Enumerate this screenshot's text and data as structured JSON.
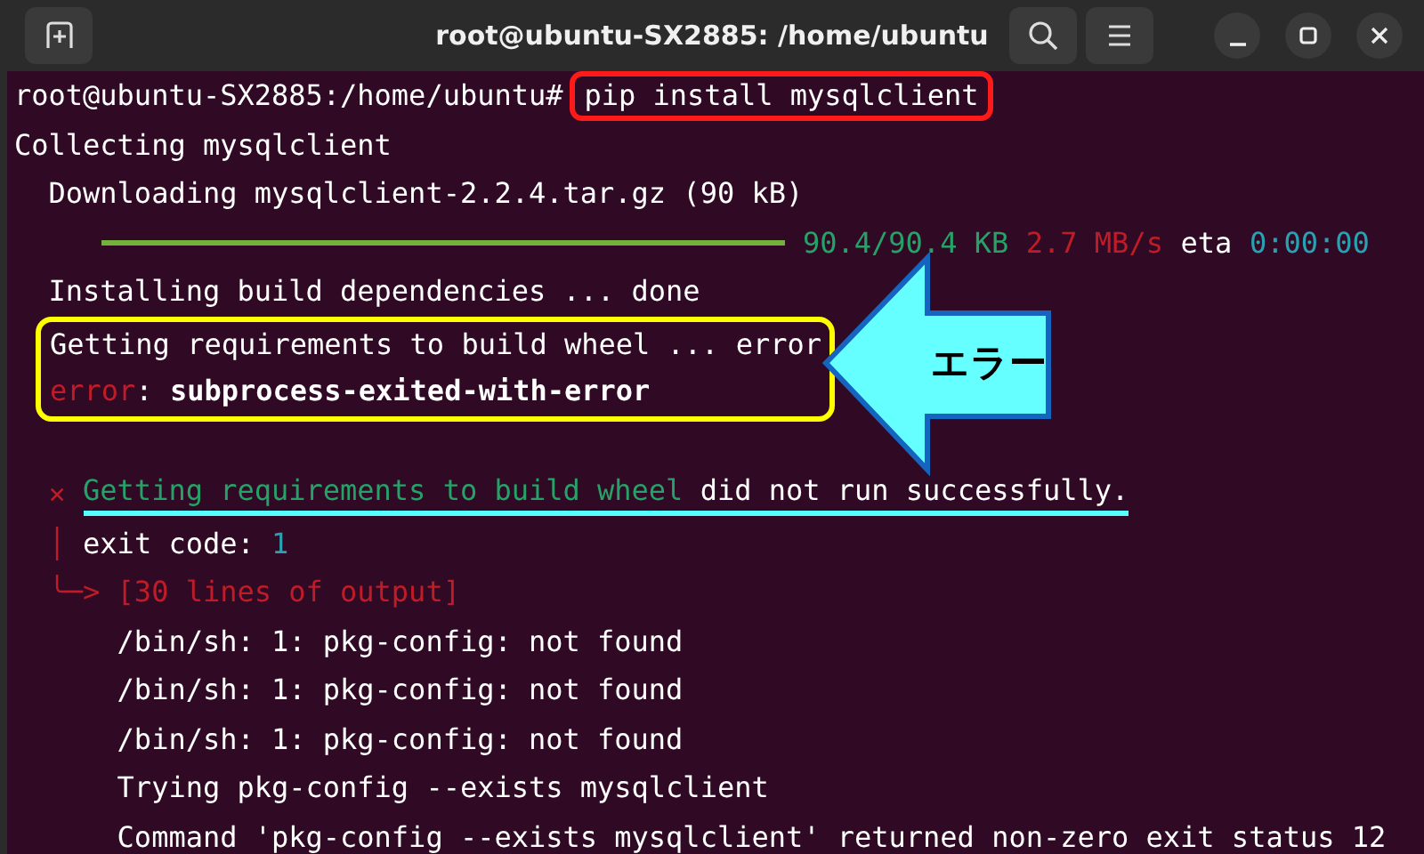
{
  "window": {
    "title": "root@ubuntu-SX2885: /home/ubuntu"
  },
  "terminal": {
    "blocks": [
      {
        "kind": "line",
        "segments": [
          {
            "kind": "plain",
            "text": "root@ubuntu-SX2885:/home/ubuntu#"
          },
          {
            "kind": "command",
            "text": "pip install mysqlclient"
          }
        ]
      },
      {
        "kind": "line",
        "segments": [
          {
            "kind": "plain",
            "text": "Collecting mysqlclient"
          }
        ]
      },
      {
        "kind": "line",
        "segments": [
          {
            "kind": "plain",
            "text": "  Downloading mysqlclient-2.2.4.tar.gz (90 kB)"
          }
        ]
      },
      {
        "kind": "progress",
        "segments": [
          {
            "kind": "green",
            "text": "90.4/90.4 KB"
          },
          {
            "kind": "red",
            "text": "2.7 MB/s"
          },
          {
            "kind": "plain",
            "text": "eta"
          },
          {
            "kind": "teal",
            "text": "0:00:00"
          }
        ]
      },
      {
        "kind": "line",
        "segments": [
          {
            "kind": "plain",
            "text": "  Installing build dependencies ... done"
          }
        ]
      },
      {
        "kind": "highlight",
        "lines": [
          {
            "segments": [
              {
                "kind": "plain",
                "text": "Getting requirements to build wheel ... error"
              }
            ]
          },
          {
            "segments": [
              {
                "kind": "red",
                "text": "error"
              },
              {
                "kind": "plain",
                "text": ": "
              },
              {
                "kind": "bold",
                "text": "subprocess-exited-with-error"
              }
            ]
          }
        ]
      },
      {
        "kind": "blank"
      },
      {
        "kind": "line",
        "segments": [
          {
            "kind": "red",
            "text": "  × "
          },
          {
            "kind": "green",
            "text": "Getting requirements to build wheel",
            "underline": true
          },
          {
            "kind": "plain",
            "text": " did not run successfully.",
            "underline": true
          }
        ]
      },
      {
        "kind": "line",
        "segments": [
          {
            "kind": "red",
            "text": "  │"
          },
          {
            "kind": "plain",
            "text": " exit code: "
          },
          {
            "kind": "teal",
            "text": "1"
          }
        ]
      },
      {
        "kind": "line",
        "segments": [
          {
            "kind": "red",
            "text": "  ╰─> [30 lines of output]"
          }
        ]
      },
      {
        "kind": "line",
        "segments": [
          {
            "kind": "plain",
            "text": "      /bin/sh: 1: pkg-config: not found"
          }
        ]
      },
      {
        "kind": "line",
        "segments": [
          {
            "kind": "plain",
            "text": "      /bin/sh: 1: pkg-config: not found"
          }
        ]
      },
      {
        "kind": "line",
        "segments": [
          {
            "kind": "plain",
            "text": "      /bin/sh: 1: pkg-config: not found"
          }
        ]
      },
      {
        "kind": "line",
        "segments": [
          {
            "kind": "plain",
            "text": "      Trying pkg-config --exists mysqlclient"
          }
        ]
      },
      {
        "kind": "line",
        "segments": [
          {
            "kind": "plain",
            "text": "      Command 'pkg-config --exists mysqlclient' returned non-zero exit status 12"
          }
        ]
      }
    ]
  },
  "callout": {
    "text": "エラー"
  }
}
